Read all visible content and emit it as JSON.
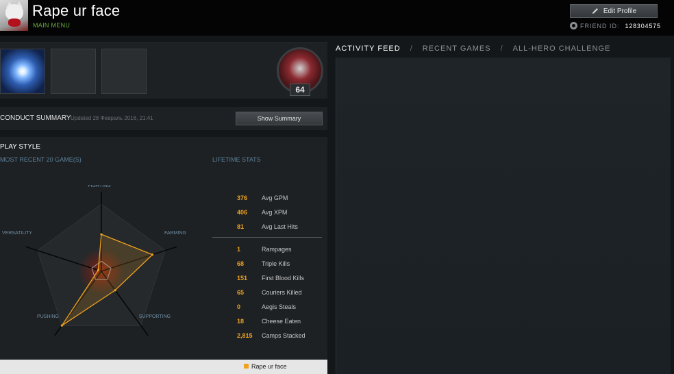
{
  "header": {
    "username": "Rape ur face",
    "main_menu": "MAIN MENU",
    "edit_profile": "Edit Profile",
    "friend_id_label": "FRIEND ID:",
    "friend_id": "128304575"
  },
  "profile": {
    "level": "64"
  },
  "conduct": {
    "title": "CONDUCT SUMMARY",
    "updated": "Updated 28 Февраль 2016, 21:41",
    "show_summary": "Show Summary"
  },
  "playstyle": {
    "title": "PLAY STYLE",
    "recent": "MOST RECENT 20 GAME(S)",
    "lifetime": "LIFETIME STATS",
    "axes": [
      "FIGHTING",
      "FARMING",
      "SUPPORTING",
      "PUSHING",
      "VERSATILITY"
    ],
    "values": [
      0.55,
      0.8,
      0.35,
      1.0,
      0.05
    ],
    "avg_values": [
      0.15,
      0.15,
      0.15,
      0.15,
      0.15
    ],
    "legend": "Rape ur face"
  },
  "stats_top": [
    {
      "value": "376",
      "label": "Avg GPM"
    },
    {
      "value": "406",
      "label": "Avg XPM"
    },
    {
      "value": "81",
      "label": "Avg Last Hits"
    }
  ],
  "stats_bottom": [
    {
      "value": "1",
      "label": "Rampages"
    },
    {
      "value": "68",
      "label": "Triple Kills"
    },
    {
      "value": "151",
      "label": "First Blood Kills"
    },
    {
      "value": "65",
      "label": "Couriers Killed"
    },
    {
      "value": "0",
      "label": "Aegis Steals"
    },
    {
      "value": "18",
      "label": "Cheese Eaten"
    },
    {
      "value": "2,815",
      "label": "Camps Stacked"
    }
  ],
  "tabs": [
    "ACTIVITY FEED",
    "RECENT GAMES",
    "ALL-HERO CHALLENGE"
  ],
  "colors": {
    "accent": "#f0a21f",
    "subheading": "#5c7f98",
    "main_menu": "#6cae3a"
  }
}
